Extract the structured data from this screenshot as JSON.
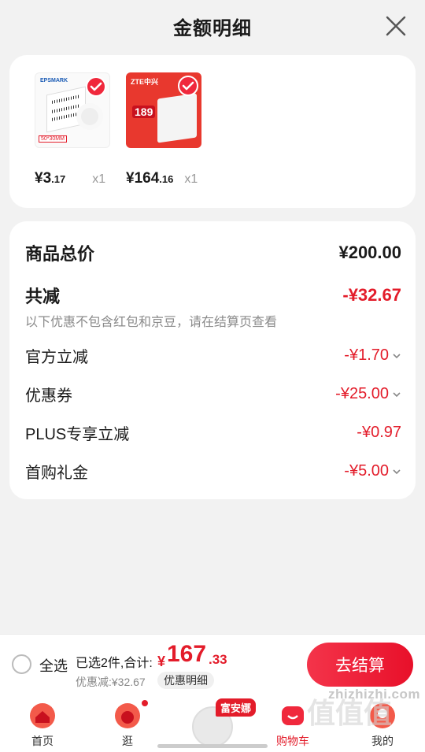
{
  "header": {
    "title": "金额明细"
  },
  "products": [
    {
      "thumb_label": "50*30MM",
      "thumb_brand": "EPSMARK",
      "price_int": "¥3",
      "price_dec": ".17",
      "qty": "x1"
    },
    {
      "thumb_label": "189",
      "thumb_brand": "ZTE中兴",
      "price_int": "¥164",
      "price_dec": ".16",
      "qty": "x1"
    }
  ],
  "summary": {
    "total_label": "商品总价",
    "total_value": "¥200.00",
    "reduce_label": "共减",
    "reduce_value": "-¥32.67",
    "note": "以下优惠不包含红包和京豆，请在结算页查看",
    "items": [
      {
        "label": "官方立减",
        "value": "-¥1.70"
      },
      {
        "label": "优惠券",
        "value": "-¥25.00"
      },
      {
        "label": "PLUS专享立减",
        "value": "-¥0.97"
      },
      {
        "label": "首购礼金",
        "value": "-¥5.00"
      }
    ]
  },
  "checkout_bar": {
    "select_all": "全选",
    "selected_text": "已选2件,合计:",
    "total_yen": "¥",
    "total_int": "167",
    "total_dec": ".33",
    "saved": "优惠减:¥32.67",
    "detail_pill": "优惠明细",
    "checkout_button": "去结算"
  },
  "tabs": [
    {
      "label": "首页",
      "icon": "home-icon"
    },
    {
      "label": "逛",
      "icon": "browse-icon"
    },
    {
      "promo_tag": "富安娜",
      "icon": "promo-icon"
    },
    {
      "label": "购物车",
      "icon": "cart-icon"
    },
    {
      "label": "我的",
      "icon": "profile-icon"
    }
  ],
  "watermark": {
    "text": "zhizhizhi.com",
    "logo": "值值值"
  },
  "colors": {
    "accent": "#e31c2a",
    "background": "#f2f2f2"
  }
}
